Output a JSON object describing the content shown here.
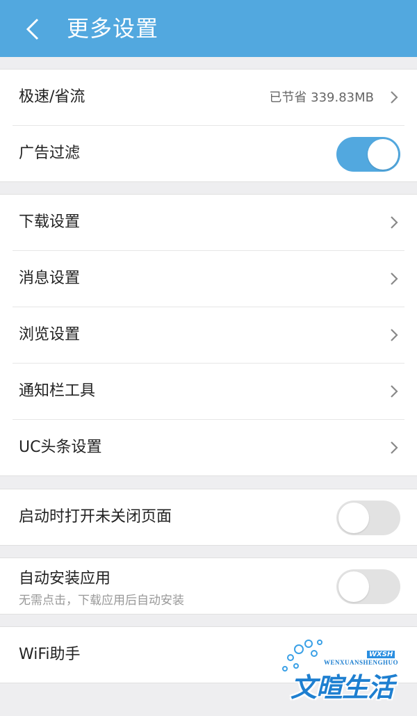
{
  "header": {
    "title": "更多设置",
    "back_icon": "chevron-left-icon"
  },
  "section1": {
    "speed_label": "极速/省流",
    "speed_value": "已节省 339.83MB",
    "ad_filter_label": "广告过滤",
    "ad_filter_on": true
  },
  "section2": {
    "items": [
      {
        "label": "下载设置"
      },
      {
        "label": "消息设置"
      },
      {
        "label": "浏览设置"
      },
      {
        "label": "通知栏工具"
      },
      {
        "label": "UC头条设置"
      }
    ]
  },
  "section3": {
    "label": "启动时打开未关闭页面",
    "on": false
  },
  "section4": {
    "label": "自动安装应用",
    "sub": "无需点击，下载应用后自动安装",
    "on": false
  },
  "section5": {
    "label": "WiFi助手"
  },
  "watermark": {
    "text": "文暄生活",
    "pinyin": "WENXUANSHENGHUO",
    "tag": "WXSH"
  },
  "colors": {
    "accent": "#52a8df",
    "toggle_off": "#e2e2e2"
  }
}
